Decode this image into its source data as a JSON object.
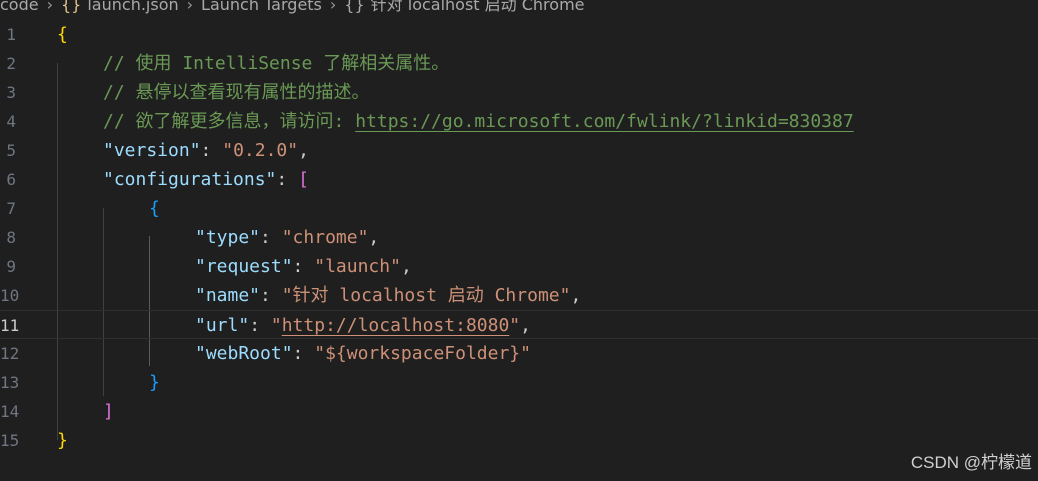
{
  "breadcrumb": {
    "items": [
      "code",
      "launch.json",
      "Launch Targets",
      "针对 localhost 启动 Chrome"
    ],
    "icons": [
      "json-braces-icon",
      "object-braces-icon"
    ]
  },
  "editor": {
    "lines": [
      {
        "num": "1"
      },
      {
        "num": "2"
      },
      {
        "num": "3"
      },
      {
        "num": "4"
      },
      {
        "num": "5"
      },
      {
        "num": "6"
      },
      {
        "num": "7"
      },
      {
        "num": "8"
      },
      {
        "num": "9"
      },
      {
        "num": "10"
      },
      {
        "num": "11"
      },
      {
        "num": "12"
      },
      {
        "num": "13"
      },
      {
        "num": "14"
      },
      {
        "num": "15"
      }
    ],
    "text": {
      "brace_open": "{",
      "brace_close": "}",
      "bracket_open": "[",
      "bracket_close": "]",
      "comment1": "// 使用 IntelliSense 了解相关属性。",
      "comment2": "// 悬停以查看现有属性的描述。",
      "comment3_prefix": "// 欲了解更多信息，请访问: ",
      "comment3_link": "https://go.microsoft.com/fwlink/?linkid=830387",
      "version_key": "\"version\"",
      "version_val": "\"0.2.0\"",
      "configurations_key": "\"configurations\"",
      "type_key": "\"type\"",
      "type_val": "\"chrome\"",
      "request_key": "\"request\"",
      "request_val": "\"launch\"",
      "name_key": "\"name\"",
      "name_val": "\"针对 localhost 启动 Chrome\"",
      "url_key": "\"url\"",
      "url_quote_open": "\"",
      "url_val": "http://localhost:8080",
      "url_quote_close": "\"",
      "webroot_key": "\"webRoot\"",
      "webroot_val": "\"${workspaceFolder}\"",
      "colon": ": ",
      "comma": ","
    },
    "active_line": "11"
  },
  "watermark": "CSDN @柠檬道"
}
